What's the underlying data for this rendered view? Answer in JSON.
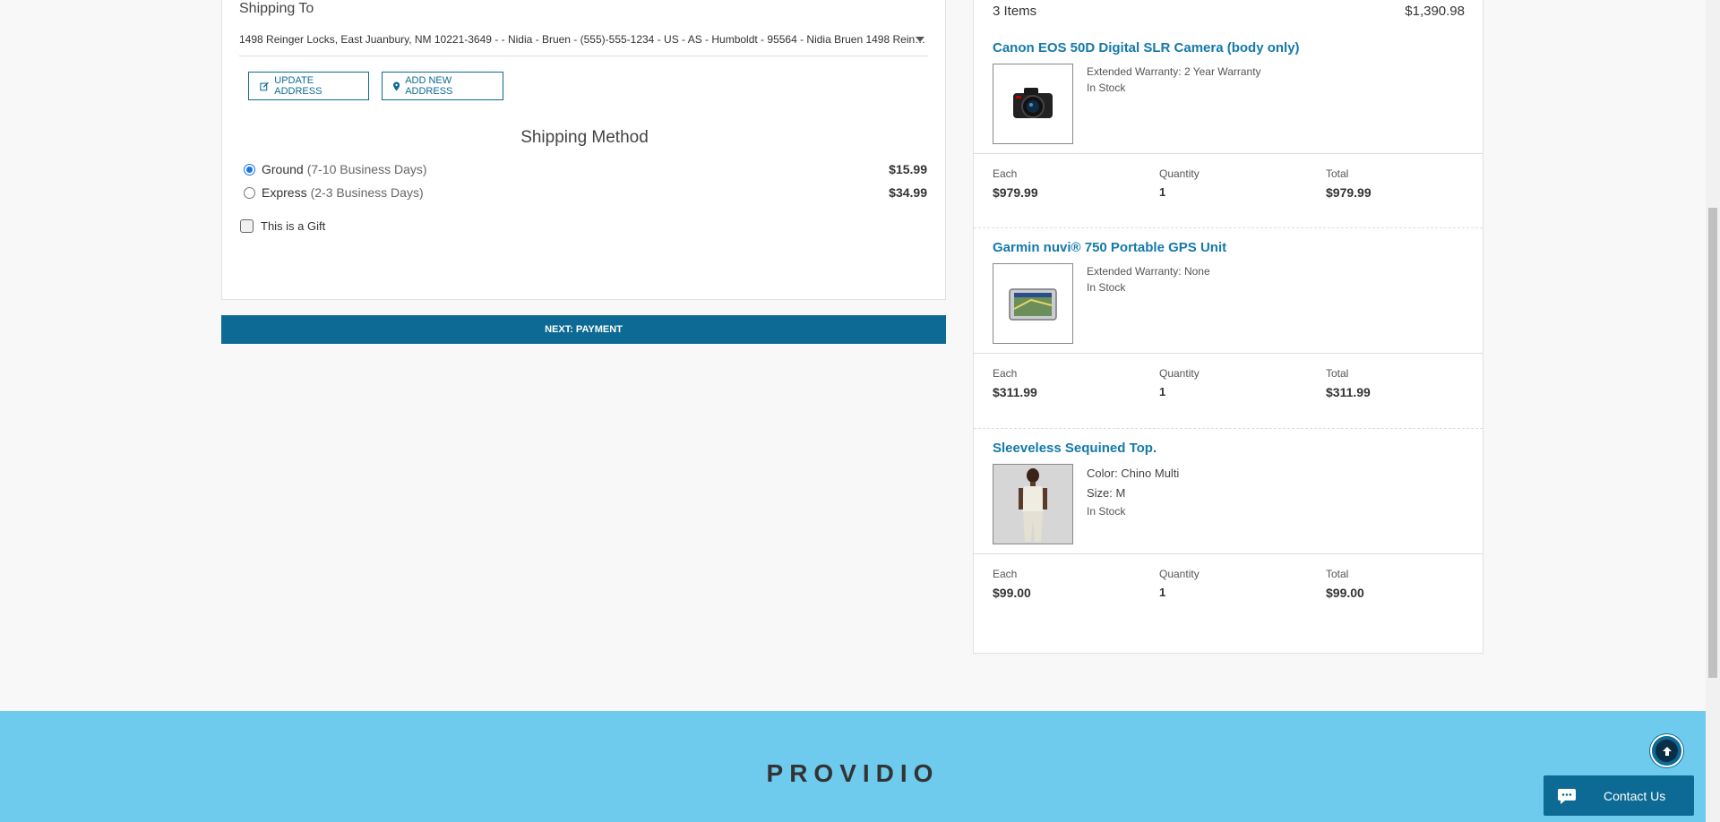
{
  "shipping": {
    "title": "Shipping To",
    "address_value": "1498 Reinger Locks, East Juanbury, NM 10221-3649 - - Nidia - Bruen - (555)-555-1234 - US - AS - Humboldt - 95564 - Nidia Bruen 1498 Rein…",
    "update_address_label": "UPDATE ADDRESS",
    "add_address_label": "ADD NEW ADDRESS",
    "method_title": "Shipping Method",
    "methods": [
      {
        "name": "Ground",
        "days": "(7-10 Business Days)",
        "price": "$15.99",
        "selected": true
      },
      {
        "name": "Express",
        "days": "(2-3 Business Days)",
        "price": "$34.99",
        "selected": false
      }
    ],
    "gift_label": "This is a Gift",
    "next_label": "NEXT: PAYMENT"
  },
  "summary": {
    "items_count": "3 Items",
    "total": "$1,390.98",
    "col_each": "Each",
    "col_qty": "Quantity",
    "col_total": "Total",
    "items": [
      {
        "title": "Canon EOS 50D Digital SLR Camera (body only)",
        "meta1": "Extended Warranty: 2 Year Warranty",
        "meta2": "In Stock",
        "each": "$979.99",
        "qty": "1",
        "total": "$979.99",
        "icon": "camera-product-image"
      },
      {
        "title": "Garmin nuvi® 750 Portable GPS Unit",
        "meta1": "Extended Warranty: None",
        "meta2": "In Stock",
        "each": "$311.99",
        "qty": "1",
        "total": "$311.99",
        "icon": "gps-product-image"
      },
      {
        "title": "Sleeveless Sequined Top.",
        "meta1": "Color: Chino Multi",
        "meta_size": "Size: M",
        "meta2": "In Stock",
        "each": "$99.00",
        "qty": "1",
        "total": "$99.00",
        "icon": "apparel-product-image"
      }
    ]
  },
  "footer": {
    "brand": "PROVIDIO",
    "contact_label": "Contact Us"
  },
  "colors": {
    "primary": "#0c6a94",
    "link": "#1479aa",
    "footer_bg": "#6ecbed"
  }
}
